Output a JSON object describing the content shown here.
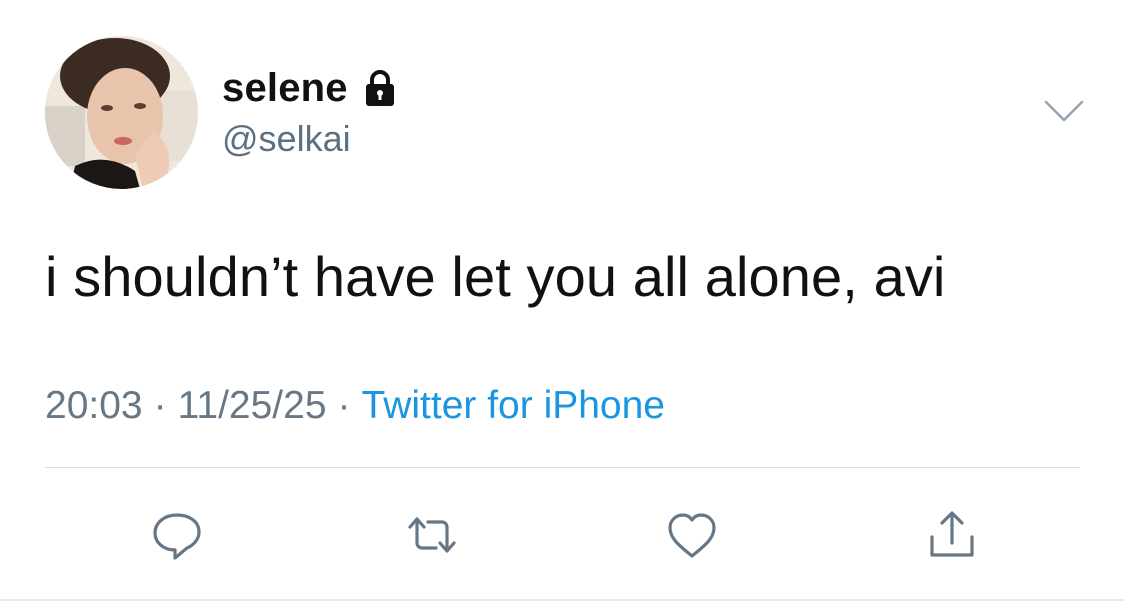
{
  "user": {
    "display_name": "selene",
    "handle": "@selkai",
    "avatar_icon": "profile-photo",
    "protected_icon": "lock-icon"
  },
  "tweet": {
    "text": "i shouldn’t have let you all alone, avi",
    "time": "20:03",
    "date": "11/25/25",
    "separator": "·",
    "source": "Twitter for iPhone"
  },
  "actions": [
    {
      "name": "reply",
      "icon": "comment-icon"
    },
    {
      "name": "retweet",
      "icon": "retweet-icon"
    },
    {
      "name": "like",
      "icon": "heart-icon"
    },
    {
      "name": "share",
      "icon": "share-icon"
    }
  ],
  "colors": {
    "text": "#111111",
    "secondary": "#687785",
    "link": "#1b95e0",
    "icon": "#657786",
    "divider": "#d9dee2"
  }
}
